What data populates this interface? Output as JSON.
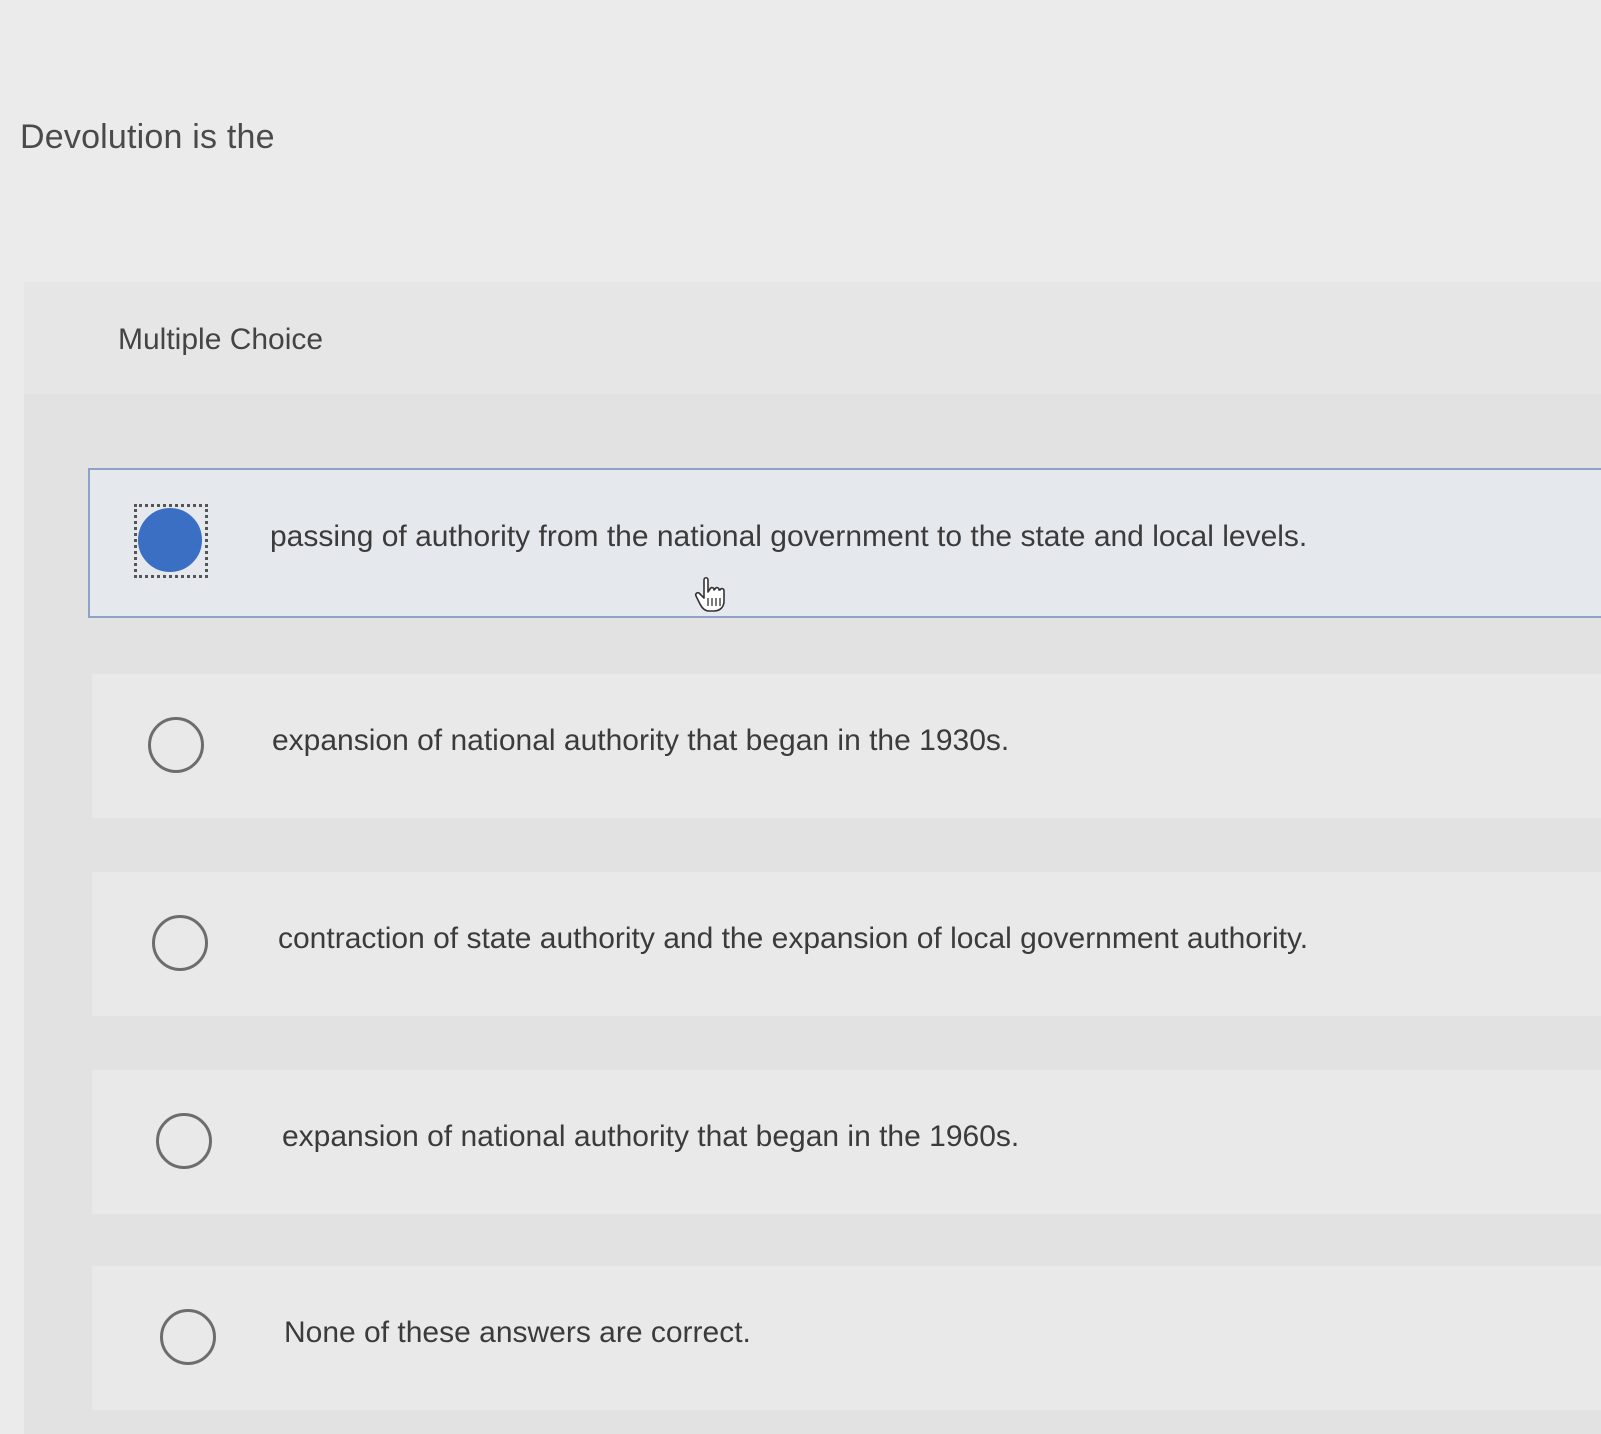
{
  "question": {
    "prompt": "Devolution is the"
  },
  "panel": {
    "label": "Multiple Choice"
  },
  "options": [
    {
      "text": "passing of authority from the national government to the state and local levels.",
      "selected": true
    },
    {
      "text": "expansion of national authority that began in the 1930s.",
      "selected": false
    },
    {
      "text": "contraction of state authority and the expansion of local government authority.",
      "selected": false
    },
    {
      "text": "expansion of national authority that began in the 1960s.",
      "selected": false
    },
    {
      "text": "None of these answers are correct.",
      "selected": false
    }
  ],
  "colors": {
    "selected_radio": "#3a6fc4",
    "selected_border": "#8ea2c8"
  },
  "icons": {
    "cursor": "hand-pointer-icon"
  }
}
